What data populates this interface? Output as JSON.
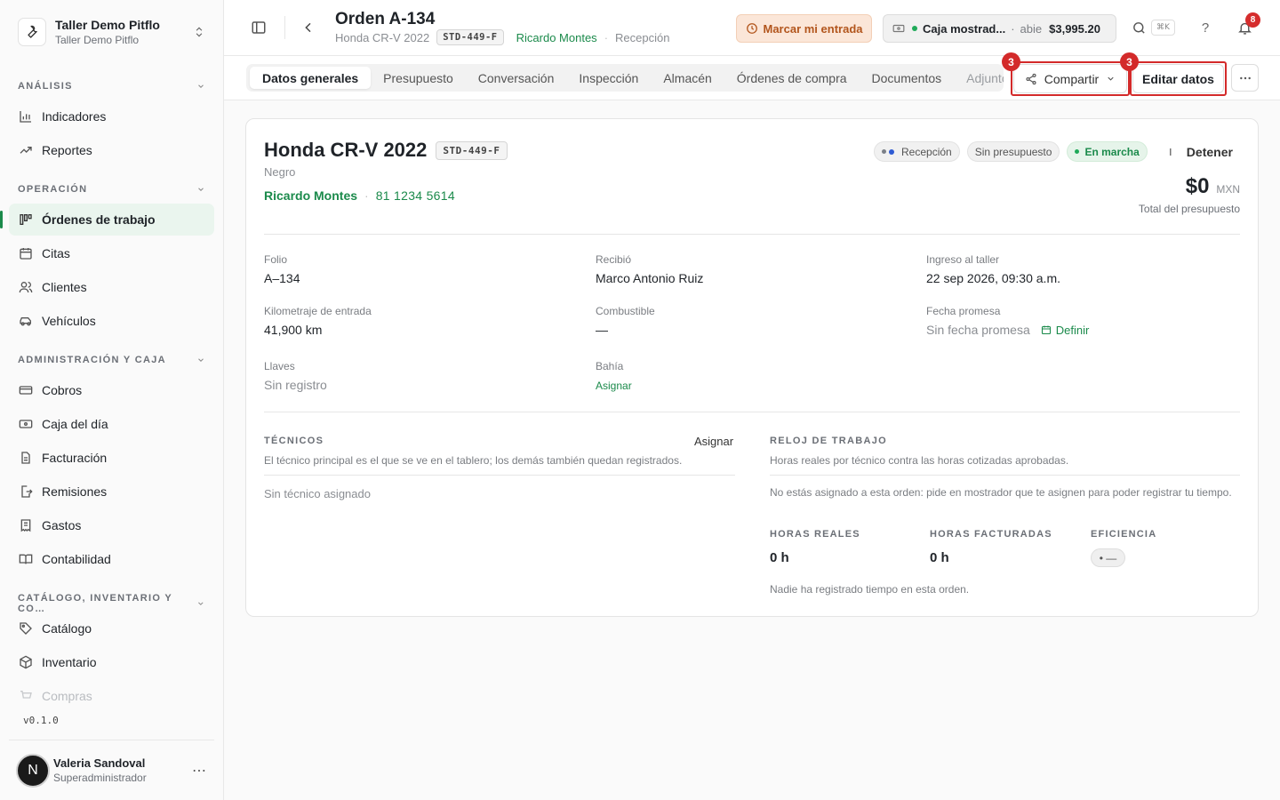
{
  "workspace": {
    "name": "Taller Demo Pitflo",
    "subtitle": "Taller Demo Pitflo"
  },
  "sidebar": {
    "sections": [
      {
        "label": "ANÁLISIS"
      },
      {
        "label": "OPERACIÓN"
      },
      {
        "label": "ADMINISTRACIÓN Y CAJA"
      },
      {
        "label": "CATÁLOGO, INVENTARIO Y CO…"
      }
    ],
    "items": [
      {
        "label": "Indicadores",
        "icon": "bar-chart-icon"
      },
      {
        "label": "Reportes",
        "icon": "trending-up-icon"
      },
      {
        "label": "Órdenes de trabajo",
        "icon": "kanban-icon"
      },
      {
        "label": "Citas",
        "icon": "calendar-icon"
      },
      {
        "label": "Clientes",
        "icon": "users-icon"
      },
      {
        "label": "Vehículos",
        "icon": "car-icon"
      },
      {
        "label": "Cobros",
        "icon": "banknote-icon"
      },
      {
        "label": "Caja del día",
        "icon": "cash-register-icon"
      },
      {
        "label": "Facturación",
        "icon": "file-text-icon"
      },
      {
        "label": "Remisiones",
        "icon": "file-export-icon"
      },
      {
        "label": "Gastos",
        "icon": "receipt-icon"
      },
      {
        "label": "Contabilidad",
        "icon": "book-open-icon"
      },
      {
        "label": "Catálogo",
        "icon": "tag-icon"
      },
      {
        "label": "Inventario",
        "icon": "box-icon"
      },
      {
        "label": "Compras",
        "icon": "cart-icon"
      }
    ],
    "version": "v0.1.0"
  },
  "user": {
    "initial": "N",
    "name": "Valeria Sandoval",
    "role": "Superadministrador"
  },
  "header": {
    "title": "Orden A-134",
    "vehicle": "Honda CR-V 2022",
    "plate": "STD-449-F",
    "customer": "Ricardo Montes",
    "stage": "Recepción",
    "entrada_label": "Marcar mi entrada",
    "caja_name": "Caja mostrad...",
    "caja_status": "abie",
    "caja_amount": "$3,995.20",
    "shortcut": "⌘K",
    "help": "?",
    "notifications": "8"
  },
  "tabs": [
    "Datos generales",
    "Presupuesto",
    "Conversación",
    "Inspección",
    "Almacén",
    "Órdenes de compra",
    "Documentos",
    "Adjuntos"
  ],
  "actions": {
    "share_label": "Compartir",
    "edit_label": "Editar datos",
    "step_badge": "3"
  },
  "vehicle": {
    "name": "Honda CR-V 2022",
    "plate": "STD-449-F",
    "color": "Negro",
    "customer": "Ricardo Montes",
    "phone": "81 1234 5614",
    "badges": {
      "stage": "Recepción",
      "budget": "Sin presupuesto",
      "running": "En marcha"
    },
    "stop_label": "Detener",
    "total": "$0",
    "currency": "MXN",
    "total_label": "Total del presupuesto"
  },
  "fields": {
    "folio": {
      "label": "Folio",
      "value": "A–134"
    },
    "received": {
      "label": "Recibió",
      "value": "Marco Antonio Ruiz"
    },
    "ingreso": {
      "label": "Ingreso al taller",
      "value": "22 sep 2026, 09:30 a.m."
    },
    "km": {
      "label": "Kilometraje de entrada",
      "value": "41,900 km"
    },
    "fuel": {
      "label": "Combustible",
      "value": "—"
    },
    "promise": {
      "label": "Fecha promesa",
      "value": "Sin fecha promesa",
      "action": "Definir"
    },
    "keys": {
      "label": "Llaves",
      "value": "Sin registro"
    },
    "bay": {
      "label": "Bahía",
      "action": "Asignar"
    }
  },
  "technicians": {
    "title": "TÉCNICOS",
    "assign": "Asignar",
    "description": "El técnico principal es el que se ve en el tablero; los demás también quedan registrados.",
    "empty": "Sin técnico asignado"
  },
  "clock": {
    "title": "RELOJ DE TRABAJO",
    "description": "Horas reales por técnico contra las horas cotizadas aprobadas.",
    "notice": "No estás asignado a esta orden: pide en mostrador que te asignen para poder registrar tu tiempo.",
    "real_label": "HORAS REALES",
    "real_value": "0 h",
    "billed_label": "HORAS FACTURADAS",
    "billed_value": "0 h",
    "eff_label": "EFICIENCIA",
    "eff_value": "• —",
    "footer": "Nadie ha registrado tiempo en esta orden."
  },
  "colors": {
    "accent": "#1b8a4b",
    "highlight": "#d32a2a",
    "active_bg": "#eaf5ee"
  }
}
